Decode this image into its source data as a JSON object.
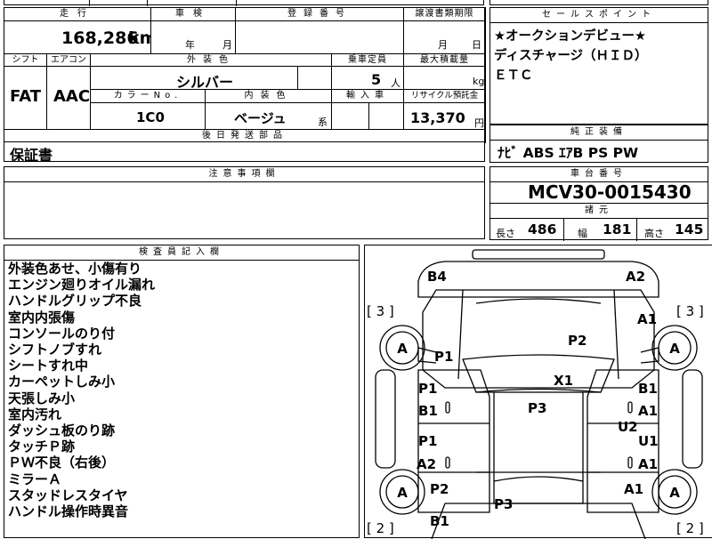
{
  "top": {
    "odometer_label": "走行",
    "odometer_value": "168,286",
    "odometer_unit": "km",
    "inspection_label": "車検",
    "inspection_year_unit": "年",
    "inspection_month_unit": "月",
    "registration_label": "登録番号",
    "transfer_deadline_label": "譲渡書類期限",
    "transfer_month_unit": "月",
    "transfer_day_unit": "日"
  },
  "row2": {
    "shift_label": "シフト",
    "shift_value": "FAT",
    "aircon_label": "エアコン",
    "aircon_value": "AAC",
    "exterior_color_label": "外装色",
    "exterior_color_value": "シルバー",
    "capacity_label": "乗車定員",
    "capacity_value": "5",
    "capacity_unit": "人",
    "max_load_label": "最大積載量",
    "max_load_unit": "kg",
    "color_no_label": "カラーNo.",
    "color_no_value": "1C0",
    "interior_color_label": "内装色",
    "interior_color_value": "ベージュ",
    "interior_color_suffix": "系",
    "import_label": "輸入車",
    "recycle_label": "リサイクル預託金",
    "recycle_value": "13,370",
    "recycle_unit": "円"
  },
  "later_parts": {
    "label": "後日発送部品",
    "value": "保証書"
  },
  "caution": {
    "label": "注意事項欄"
  },
  "sales_points": {
    "label": "セールスポイント",
    "lines": [
      "★オークションデビュー★",
      "ディスチャージ（ＨＩＤ）",
      "ＥＴＣ"
    ]
  },
  "equipment": {
    "label": "純正装備",
    "value": "ﾅﾋﾞ ABS ｴｱB PS PW"
  },
  "chassis": {
    "label": "車台番号",
    "value": "MCV30-0015430"
  },
  "dimensions": {
    "label": "諸元",
    "length_label": "長さ",
    "length_value": "486",
    "width_label": "幅",
    "width_value": "181",
    "height_label": "高さ",
    "height_value": "145"
  },
  "inspector": {
    "label": "検査員記入欄",
    "notes": [
      "外装色あせ、小傷有り",
      "エンジン廻りオイル漏れ",
      "ハンドルグリップ不良",
      "室内内張傷",
      "コンソールのり付",
      "シフトノブすれ",
      "シートすれ中",
      "カーペットしみ小",
      "天張しみ小",
      "室内汚れ",
      "ダッシュ板のり跡",
      "タッチＰ跡",
      "ＰＷ不良（右後）",
      "ミラーＡ",
      "スタッドレスタイヤ",
      "ハンドル操作時異音"
    ]
  },
  "diagram": {
    "tire_left_front": "[ 3 ]",
    "tire_right_front": "[ 3 ]",
    "tire_left_rear": "[ 2 ]",
    "tire_right_rear": "[ 2 ]",
    "wheel_mark": "A",
    "marks": {
      "front_left_bumper": "B4",
      "front_right_bumper": "A2",
      "right_front_fender": "A1",
      "hood": "P2",
      "left_front_fender": "P1",
      "windshield": "X1",
      "left_front_door_a": "P1",
      "left_front_door_b": "B1",
      "right_front_door_a": "B1",
      "right_front_door_b": "A1",
      "roof": "P3",
      "right_pillar": "U2",
      "left_rear_door_a": "P1",
      "left_rear_door_b": "A2",
      "right_rear_door_a": "U1",
      "right_rear_door_b": "A1",
      "left_rear_fender": "P2",
      "right_rear_fender": "A1",
      "trunk": "P3",
      "rear_left": "B1"
    }
  }
}
